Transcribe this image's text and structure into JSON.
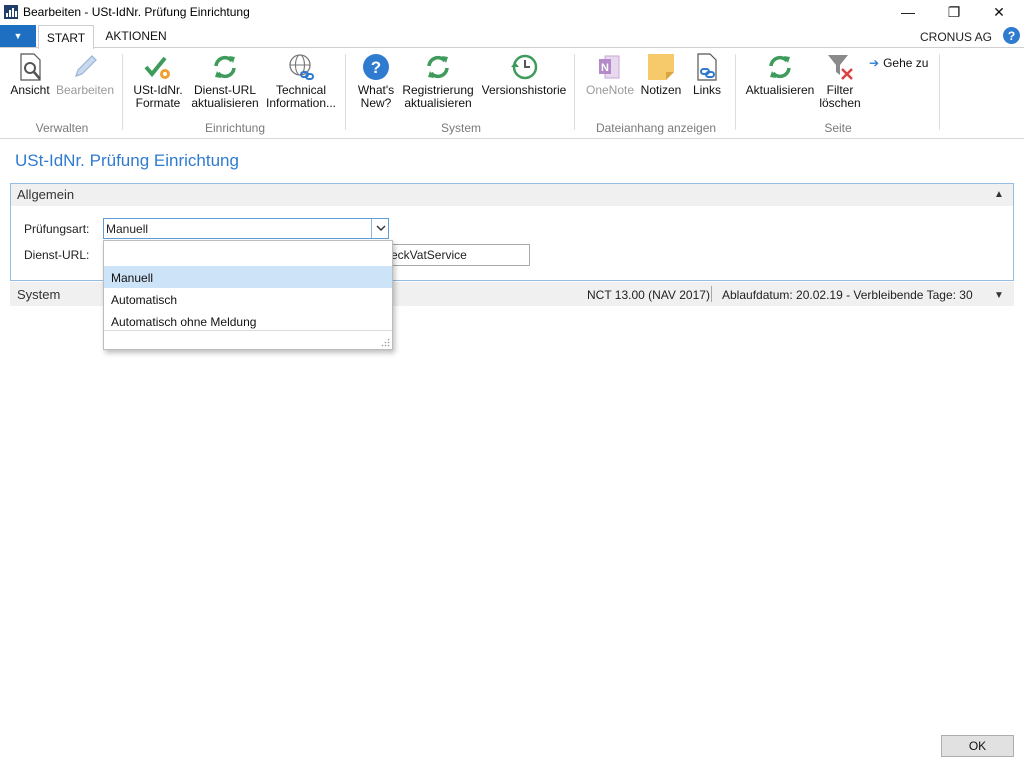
{
  "window": {
    "title": "Bearbeiten - USt-IdNr. Prüfung Einrichtung",
    "minimize": "—",
    "maximize": "❐",
    "close": "✕"
  },
  "menu": {
    "dropdown_glyph": "▼",
    "tabs": [
      {
        "label": "START",
        "active": true
      },
      {
        "label": "AKTIONEN",
        "active": false
      }
    ],
    "company": "CRONUS AG",
    "help_glyph": "?"
  },
  "ribbon": {
    "groups": [
      {
        "label": "Verwalten"
      },
      {
        "label": "Einrichtung"
      },
      {
        "label": "System"
      },
      {
        "label": "Dateianhang anzeigen"
      },
      {
        "label": "Seite"
      }
    ],
    "buttons": {
      "ansicht": {
        "line1": "Ansicht",
        "line2": "",
        "icon": "view-icon"
      },
      "bearbeiten": {
        "line1": "Bearbeiten",
        "line2": "",
        "icon": "edit-pencil-icon",
        "disabled": true
      },
      "formate": {
        "line1": "USt-IdNr.",
        "line2": "Formate",
        "icon": "check-gear-icon"
      },
      "dienst_url": {
        "line1": "Dienst-URL",
        "line2": "aktualisieren",
        "icon": "refresh-icon"
      },
      "technical": {
        "line1": "Technical",
        "line2": "Information...",
        "icon": "globe-link-icon"
      },
      "whats_new": {
        "line1": "What's",
        "line2": "New?",
        "icon": "question-icon"
      },
      "registrierung": {
        "line1": "Registrierung",
        "line2": "aktualisieren",
        "icon": "refresh-icon"
      },
      "versionshistorie": {
        "line1": "Versionshistorie",
        "line2": "",
        "icon": "history-clock-icon"
      },
      "onenote": {
        "line1": "OneNote",
        "line2": "",
        "icon": "onenote-icon",
        "disabled": true
      },
      "notizen": {
        "line1": "Notizen",
        "line2": "",
        "icon": "note-icon"
      },
      "links": {
        "line1": "Links",
        "line2": "",
        "icon": "link-icon"
      },
      "aktualisieren": {
        "line1": "Aktualisieren",
        "line2": "",
        "icon": "refresh-icon"
      },
      "filter": {
        "line1": "Filter",
        "line2": "löschen",
        "icon": "clear-filter-icon"
      },
      "gehe_zu": {
        "line1": "Gehe zu",
        "icon": "arrow-right-icon"
      }
    },
    "colors": {
      "green": "#3f9b5c",
      "blue": "#2f7bd0",
      "disabled": "#9a9a9a"
    }
  },
  "page": {
    "title": "USt-IdNr. Prüfung Einrichtung",
    "fasttab": {
      "title": "Allgemein",
      "fields": {
        "pruefungsart_label": "Prüfungsart:",
        "pruefungsart_value": "Manuell",
        "dienst_url_label": "Dienst-URL:",
        "dienst_url_value": "eckVatService"
      }
    },
    "dropdown": {
      "options": [
        "Manuell",
        "Automatisch",
        "Automatisch ohne Meldung"
      ],
      "selected": "Manuell"
    },
    "system": {
      "label": "System",
      "version": "NCT 13.00 (NAV 2017)",
      "expiry": "Ablaufdatum: 20.02.19 - Verbleibende Tage: 30"
    }
  },
  "footer": {
    "ok_label": "OK"
  }
}
